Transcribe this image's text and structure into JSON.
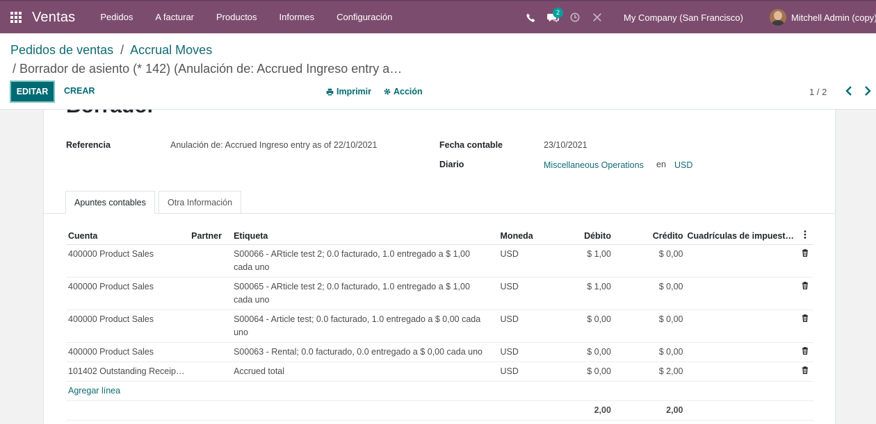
{
  "navbar": {
    "app_title": "Ventas",
    "menu": [
      "Pedidos",
      "A facturar",
      "Productos",
      "Informes",
      "Configuración"
    ],
    "chat_badge": "2",
    "company": "My Company (San Francisco)",
    "user": "Mitchell Admin (copy)"
  },
  "breadcrumb": {
    "root": "Pedidos de ventas",
    "sep1": "/",
    "level2": "Accrual Moves",
    "current": "/ Borrador de asiento (* 142) (Anulación de: Accrued Ingreso entry a…"
  },
  "toolbar": {
    "edit_label": "EDITAR",
    "create_label": "CREAR",
    "print_label": "Imprimir",
    "action_label": "Acción",
    "pager": "1 / 2"
  },
  "form": {
    "title": "Borrador",
    "referencia_label": "Referencia",
    "referencia_value": "Anulación de: Accrued Ingreso entry as of 22/10/2021",
    "fecha_label": "Fecha contable",
    "fecha_value": "23/10/2021",
    "diario_label": "Diario",
    "diario_value": "Miscellaneous Operations",
    "en_label": "en",
    "currency_value": "USD"
  },
  "tabs": [
    "Apuntes contables",
    "Otra Información"
  ],
  "lines_table": {
    "columns": [
      "Cuenta",
      "Partner",
      "Etiqueta",
      "Moneda",
      "Débito",
      "Crédito",
      "Cuadrículas de impuest…"
    ],
    "rows": [
      {
        "cuenta": "400000 Product Sales",
        "partner": "",
        "etiqueta_1": "S00066 - ARticle test 2; 0.0 facturado, 1.0 entregado a $ 1,00",
        "etiqueta_2": "cada uno",
        "moneda": "USD",
        "debito": "$ 1,00",
        "credito": "$ 0,00"
      },
      {
        "cuenta": "400000 Product Sales",
        "partner": "",
        "etiqueta_1": "S00065 - ARticle test 2; 0.0 facturado, 1.0 entregado a $ 1,00",
        "etiqueta_2": "cada uno",
        "moneda": "USD",
        "debito": "$ 1,00",
        "credito": "$ 0,00"
      },
      {
        "cuenta": "400000 Product Sales",
        "partner": "",
        "etiqueta_1": "S00064 - Article test; 0.0 facturado, 1.0 entregado a $ 0,00 cada",
        "etiqueta_2": "uno",
        "moneda": "USD",
        "debito": "$ 0,00",
        "credito": "$ 0,00"
      },
      {
        "cuenta": "400000 Product Sales",
        "partner": "",
        "etiqueta_1": "S00063 - Rental; 0.0 facturado, 0.0 entregado a $ 0,00 cada uno",
        "etiqueta_2": "",
        "moneda": "USD",
        "debito": "$ 0,00",
        "credito": "$ 0,00"
      },
      {
        "cuenta": "101402 Outstanding Receip…",
        "partner": "",
        "etiqueta_1": "Accrued total",
        "etiqueta_2": "",
        "moneda": "USD",
        "debito": "$ 0,00",
        "credito": "$ 2,00"
      }
    ],
    "add_line": "Agregar línea",
    "total_debito": "2,00",
    "total_credito": "2,00"
  },
  "colors": {
    "navbar": "#7c4c6e",
    "primary": "#016b73",
    "link": "#0f6b73",
    "badge": "#00a09d"
  }
}
